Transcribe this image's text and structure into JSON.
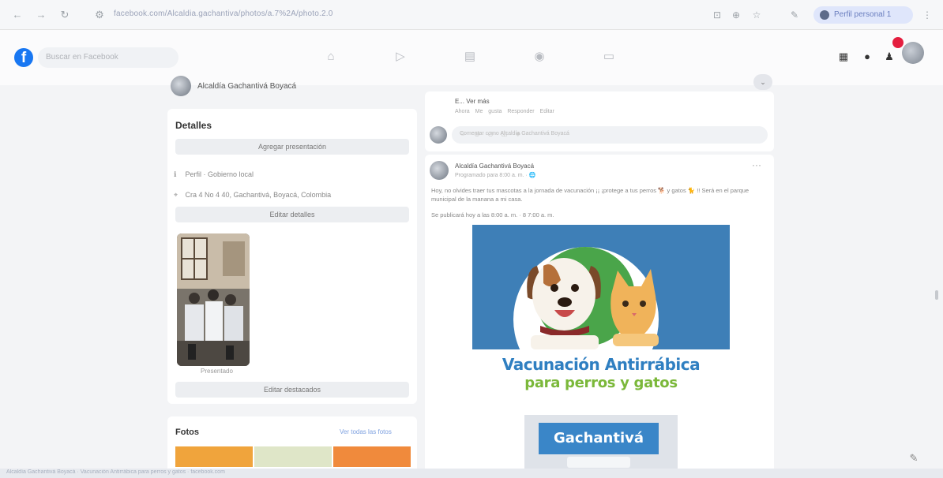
{
  "browser": {
    "url": "facebook.com/Alcaldia.gachantiva/photos/a.7%2A/photo.2.0",
    "profile_label": "Perfil personal 1"
  },
  "header": {
    "logo": "f",
    "search_placeholder": "Buscar en Facebook"
  },
  "page": {
    "name": "Alcaldía Gachantivá Boyacá"
  },
  "details": {
    "title": "Detalles",
    "add_intro_button": "Agregar presentación",
    "rows": [
      {
        "icon": "info-icon",
        "glyph": "ℹ",
        "text": "Perfil · Gobierno local"
      },
      {
        "icon": "location-icon",
        "glyph": "⌖",
        "text": "Cra 4 No 4 40, Gachantivá, Boyacá, Colombia"
      }
    ],
    "edit_details_button": "Editar detalles",
    "featured_label": "Presentado",
    "edit_featured_button": "Editar destacados"
  },
  "photos": {
    "title": "Fotos",
    "see_all_link": "Ver todas las fotos",
    "thumb_colors": [
      "#f0a43c",
      "#dfe6c8",
      "#f08a3c"
    ]
  },
  "comment_preview": {
    "name": "E... Ver más",
    "actions": "Ahora Me gusta Responder Editar",
    "input_placeholder": "Comentar como Alcaldía Gachantivá Boyacá",
    "emoji_row": "☺ ◎ ◷ ◫ ◈"
  },
  "post": {
    "author": "Alcaldía Gachantivá Boyacá",
    "meta": "Programado para 8:00 a. m. · 🌐",
    "more_icon": "···",
    "text": "Hoy, no olvides traer tus mascotas a la jornada de vacunación ¡¡ ¡protege a tus perros 🐕 y gatos 🐈 !! Será en el parque municipal de la manana a mi casa.",
    "schedule": "Se publicará hoy a las 8:00 a. m. · 8 7:00 a. m.",
    "poster": {
      "title": "Vacunación Antirrábica",
      "subtitle": "para perros y gatos",
      "badge": "Gachantivá",
      "colors": {
        "blue": "#3e7fb7",
        "green": "#4aa54a",
        "title": "#2f7fc1",
        "subtitle": "#7bb83a"
      }
    }
  },
  "footer_strip": "Alcaldía Gachantivá Boyacá · Vacunación Antirrábica para perros y gatos · facebook.com"
}
